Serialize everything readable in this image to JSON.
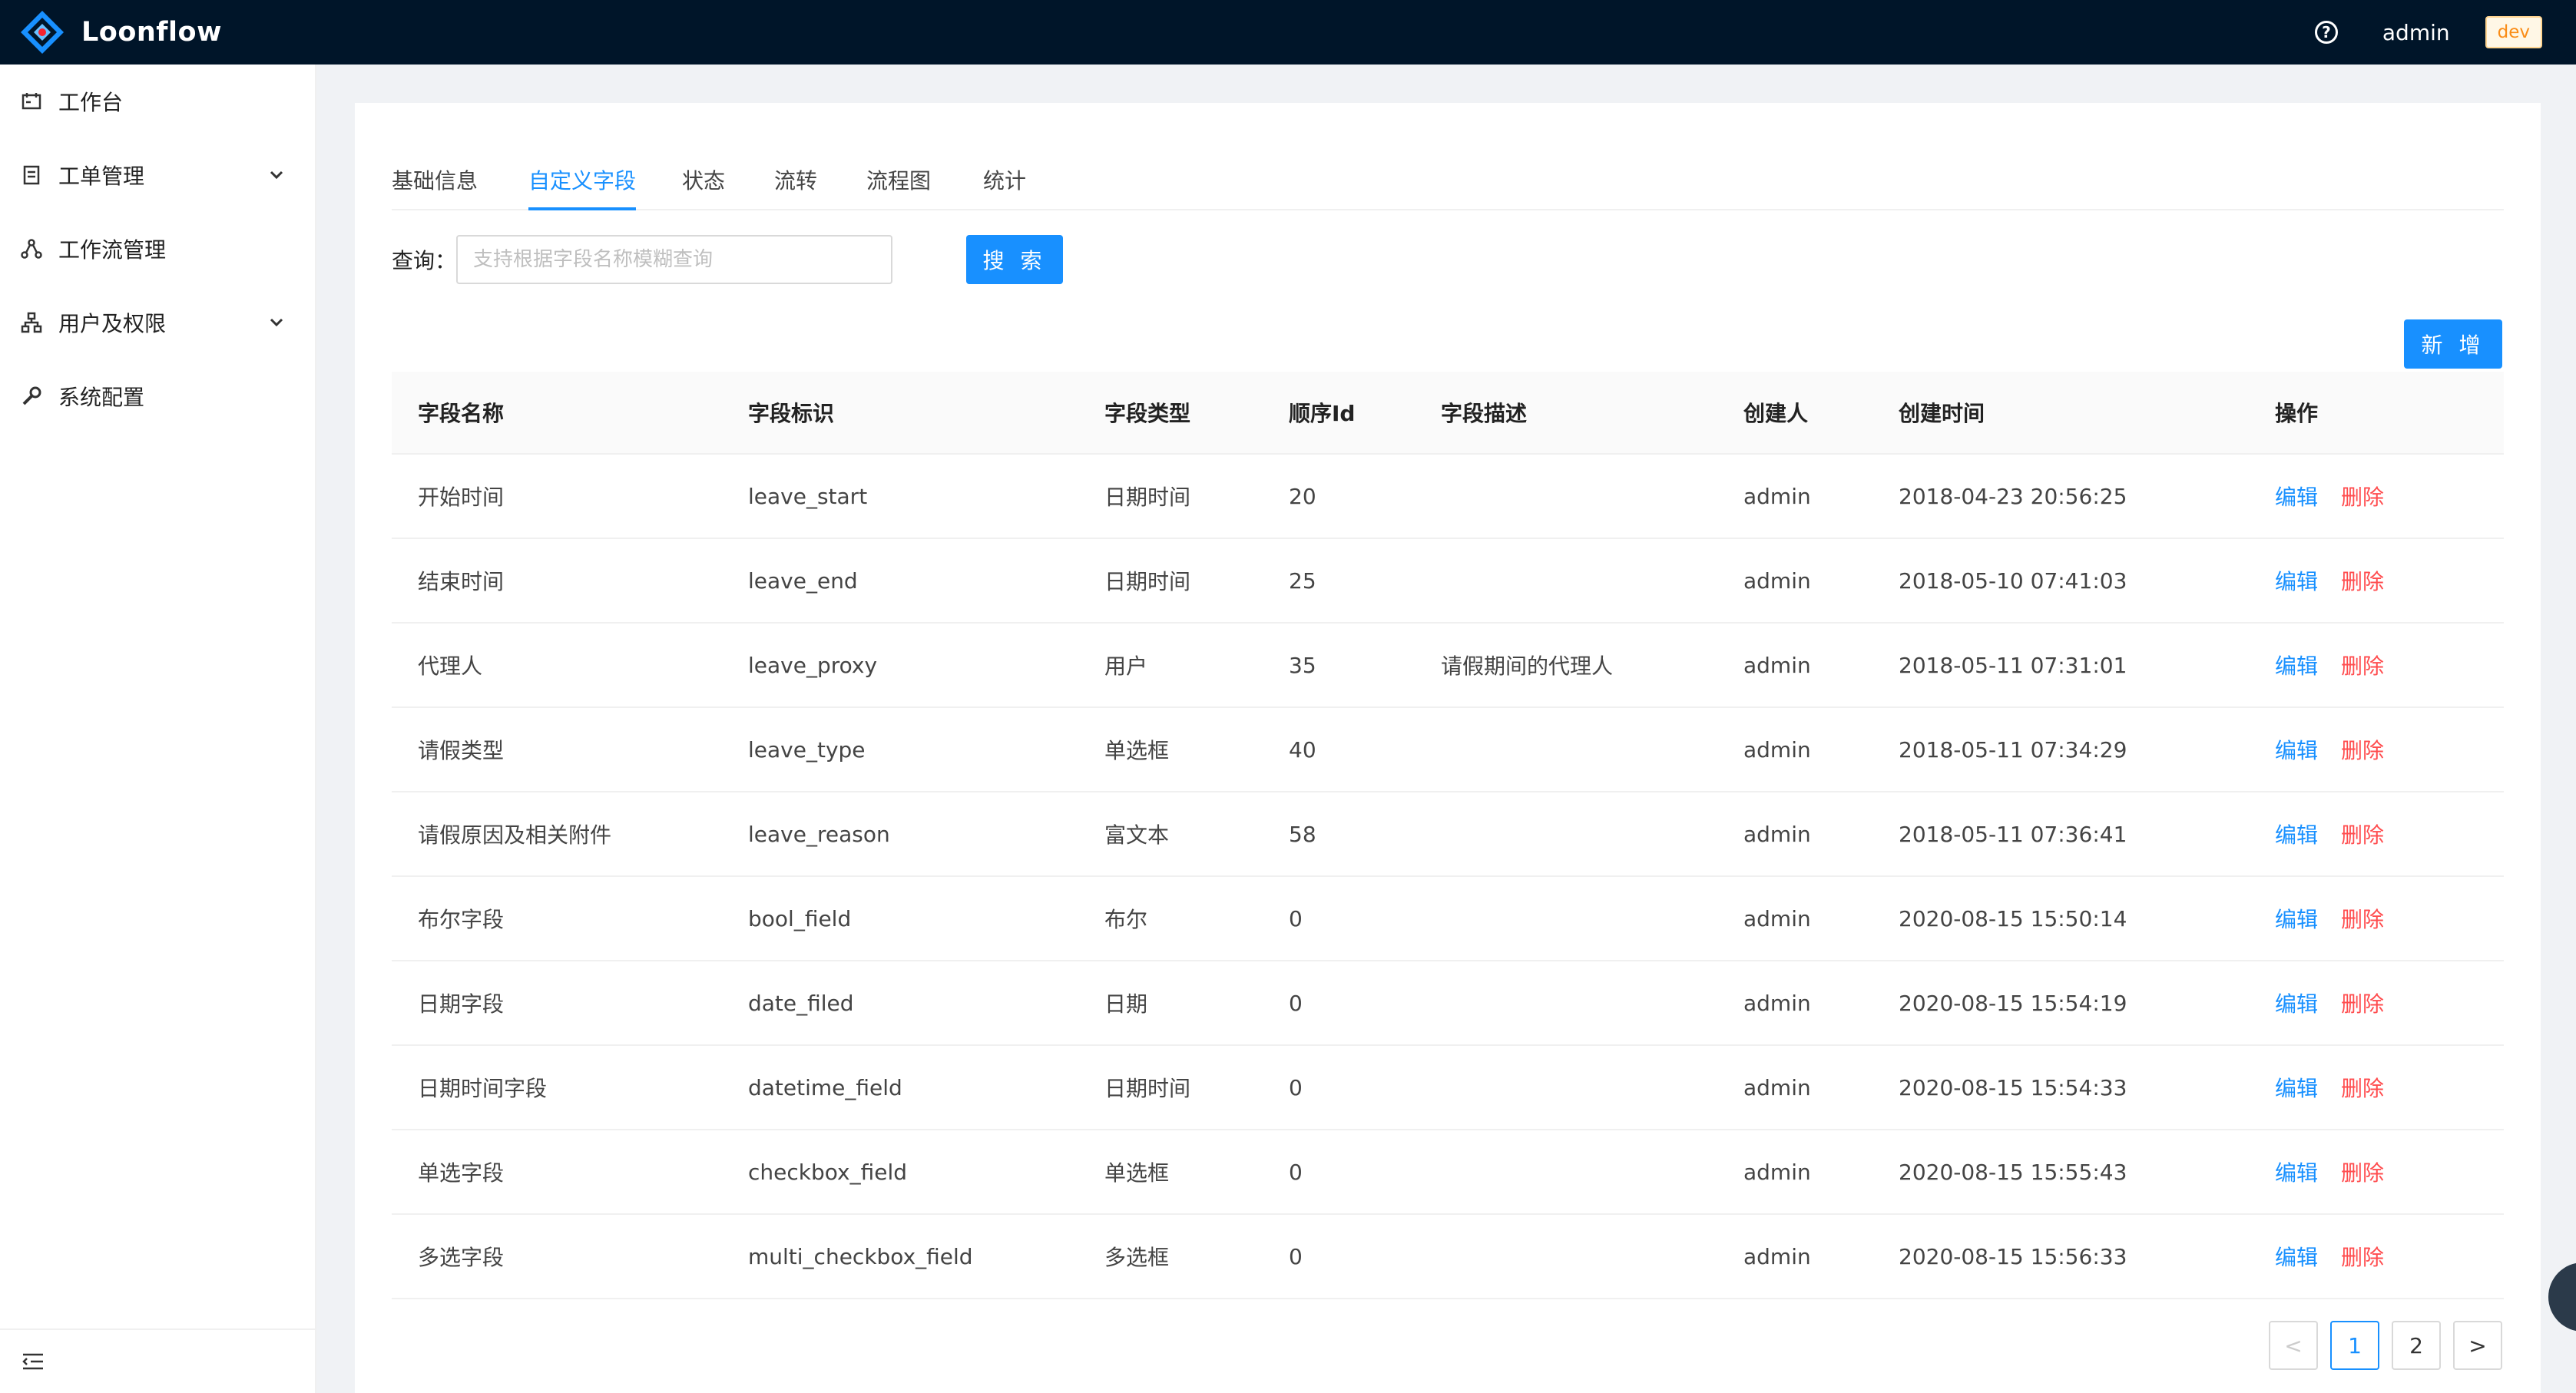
{
  "app": {
    "title": "Loonflow",
    "user": "admin",
    "env_badge": "dev",
    "colors": {
      "header_bg": "#001529",
      "primary": "#1890ff",
      "danger": "#ff4d4f"
    }
  },
  "sidebar": {
    "items": [
      {
        "label": "工作台",
        "icon": "dashboard-icon"
      },
      {
        "label": "工单管理",
        "icon": "ticket-icon",
        "expandable": true
      },
      {
        "label": "工作流管理",
        "icon": "workflow-icon"
      },
      {
        "label": "用户及权限",
        "icon": "org-icon",
        "expandable": true
      },
      {
        "label": "系统配置",
        "icon": "wrench-icon"
      }
    ],
    "collapse_icon": "menu-fold-icon"
  },
  "tabs": [
    {
      "label": "基础信息",
      "active": false
    },
    {
      "label": "自定义字段",
      "active": true
    },
    {
      "label": "状态",
      "active": false
    },
    {
      "label": "流转",
      "active": false
    },
    {
      "label": "流程图",
      "active": false
    },
    {
      "label": "统计",
      "active": false
    }
  ],
  "query": {
    "label": "查询：",
    "placeholder": "支持根据字段名称模糊查询",
    "value": "",
    "search_button": "搜 索"
  },
  "add_button": "新 增",
  "table": {
    "columns": [
      "字段名称",
      "字段标识",
      "字段类型",
      "顺序Id",
      "字段描述",
      "创建人",
      "创建时间",
      "操作"
    ],
    "action_edit": "编辑",
    "action_delete": "删除",
    "rows": [
      [
        "开始时间",
        "leave_start",
        "日期时间",
        "20",
        "",
        "admin",
        "2018-04-23 20:56:25"
      ],
      [
        "结束时间",
        "leave_end",
        "日期时间",
        "25",
        "",
        "admin",
        "2018-05-10 07:41:03"
      ],
      [
        "代理人",
        "leave_proxy",
        "用户",
        "35",
        "请假期间的代理人",
        "admin",
        "2018-05-11 07:31:01"
      ],
      [
        "请假类型",
        "leave_type",
        "单选框",
        "40",
        "",
        "admin",
        "2018-05-11 07:34:29"
      ],
      [
        "请假原因及相关附件",
        "leave_reason",
        "富文本",
        "58",
        "",
        "admin",
        "2018-05-11 07:36:41"
      ],
      [
        "布尔字段",
        "bool_field",
        "布尔",
        "0",
        "",
        "admin",
        "2020-08-15 15:50:14"
      ],
      [
        "日期字段",
        "date_filed",
        "日期",
        "0",
        "",
        "admin",
        "2020-08-15 15:54:19"
      ],
      [
        "日期时间字段",
        "datetime_field",
        "日期时间",
        "0",
        "",
        "admin",
        "2020-08-15 15:54:33"
      ],
      [
        "单选字段",
        "checkbox_field",
        "单选框",
        "0",
        "",
        "admin",
        "2020-08-15 15:55:43"
      ],
      [
        "多选字段",
        "multi_checkbox_field",
        "多选框",
        "0",
        "",
        "admin",
        "2020-08-15 15:56:33"
      ]
    ]
  },
  "pagination": {
    "prev": "<",
    "pages": [
      "1",
      "2"
    ],
    "current": "1",
    "next": ">"
  }
}
